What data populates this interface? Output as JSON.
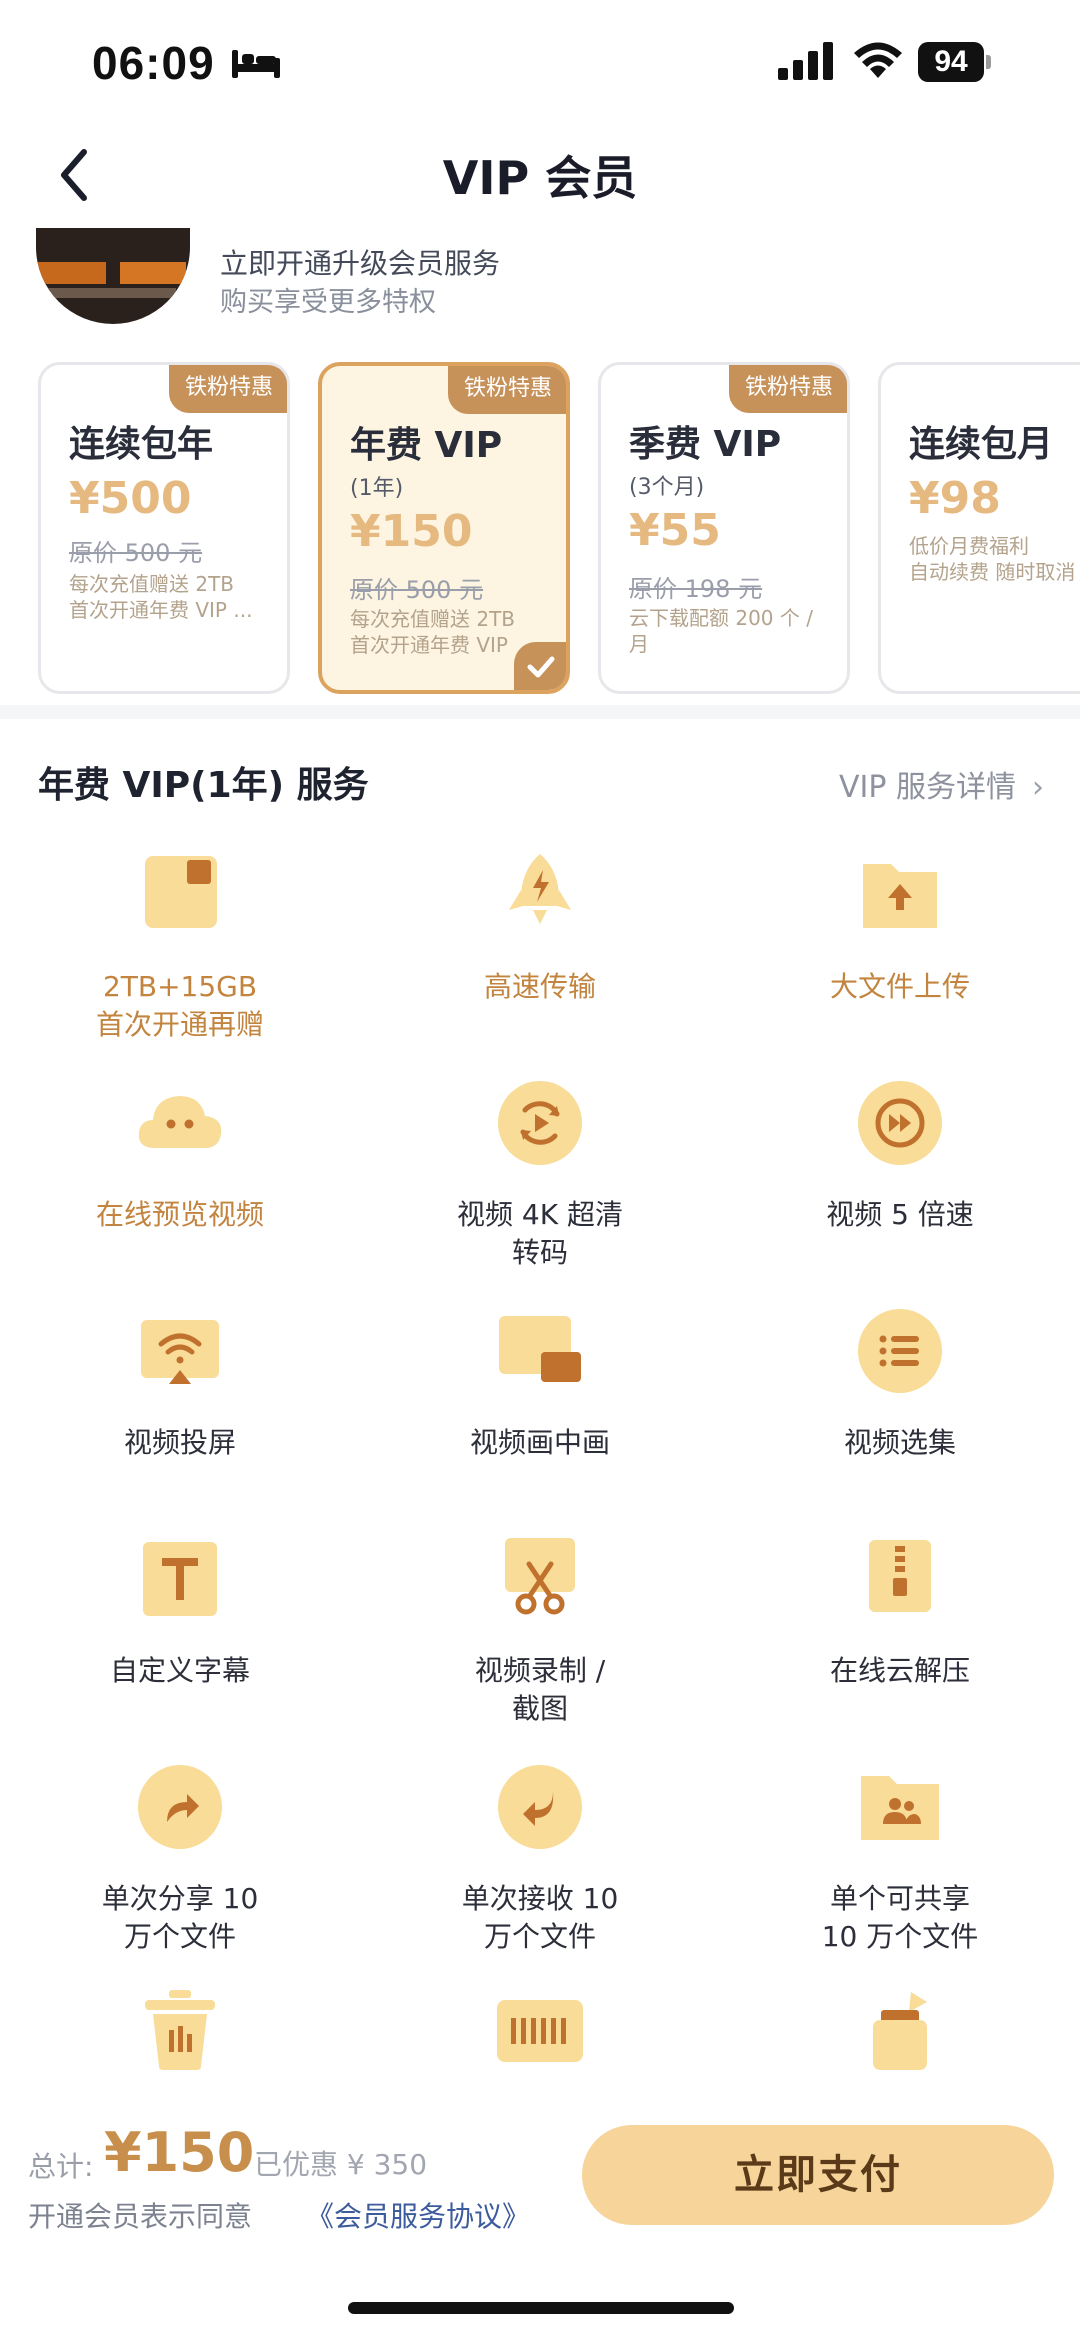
{
  "status": {
    "time": "06:09",
    "battery": "94"
  },
  "nav": {
    "title": "VIP 会员"
  },
  "promo": {
    "line1": "立即开通升级会员服务",
    "line2": "购买享受更多特权"
  },
  "plans": [
    {
      "badge": "铁粉特惠",
      "name": "连续包年",
      "price": "¥500",
      "orig": "原价 500 元",
      "note1": "每次充值赠送 2TB",
      "note2": "首次开通年费 VIP ..."
    },
    {
      "badge": "铁粉特惠",
      "name": "年费 VIP",
      "sub": "(1年)",
      "price": "¥150",
      "orig": "原价 500 元",
      "note1": "每次充值赠送 2TB",
      "note2": "首次开通年费 VIP"
    },
    {
      "badge": "铁粉特惠",
      "name": "季费 VIP",
      "sub": "(3个月)",
      "price": "¥55",
      "orig": "原价 198 元",
      "note1": "云下载配额 200 个 /",
      "note2": "月"
    },
    {
      "name": "连续包月",
      "price": "¥98",
      "note1": "低价月费福利",
      "note2": "自动续费 随时取消"
    }
  ],
  "services": {
    "title": "年费 VIP(1年) 服务",
    "detail_link": "VIP 服务详情",
    "items": [
      {
        "label1": "2TB+15GB",
        "label2": "首次开通再赠",
        "icon": "storage-icon"
      },
      {
        "label1": "高速传输",
        "label2": "",
        "icon": "rocket-icon"
      },
      {
        "label1": "大文件上传",
        "label2": "",
        "icon": "folder-upload-icon"
      },
      {
        "label1": "在线预览视频",
        "label2": "",
        "icon": "cloud-icon"
      },
      {
        "label1": "视频 4K 超清",
        "label2": "转码",
        "icon": "video-4k-icon"
      },
      {
        "label1": "视频 5 倍速",
        "label2": "",
        "icon": "fast-forward-icon"
      },
      {
        "label1": "视频投屏",
        "label2": "",
        "icon": "cast-icon"
      },
      {
        "label1": "视频画中画",
        "label2": "",
        "icon": "picture-in-picture-icon"
      },
      {
        "label1": "视频选集",
        "label2": "",
        "icon": "episode-list-icon"
      },
      {
        "label1": "自定义字幕",
        "label2": "",
        "icon": "subtitle-icon"
      },
      {
        "label1": "视频录制 /",
        "label2": "截图",
        "icon": "scissors-icon"
      },
      {
        "label1": "在线云解压",
        "label2": "",
        "icon": "zip-icon"
      },
      {
        "label1": "单次分享 10",
        "label2": "万个文件",
        "icon": "share-icon"
      },
      {
        "label1": "单次接收 10",
        "label2": "万个文件",
        "icon": "receive-icon"
      },
      {
        "label1": "单个可共享",
        "label2": "10 万个文件",
        "icon": "shared-folder-icon"
      },
      {
        "label1": "",
        "label2": "",
        "icon": "trash-icon"
      },
      {
        "label1": "",
        "label2": "",
        "icon": "barcode-icon"
      },
      {
        "label1": "",
        "label2": "",
        "icon": "ink-bottle-icon"
      }
    ]
  },
  "bottom": {
    "total_label": "总计:",
    "total_value": "¥150",
    "saved": "已优惠 ¥ 350",
    "agree_text": "开通会员表示同意",
    "agree_link": "《会员服务协议》",
    "pay_button": "立即支付"
  },
  "colors": {
    "accent": "#c7915a",
    "icon_fill": "#f8dc97",
    "icon_dark": "#c0712e",
    "pay_button": "#f6d49a"
  }
}
